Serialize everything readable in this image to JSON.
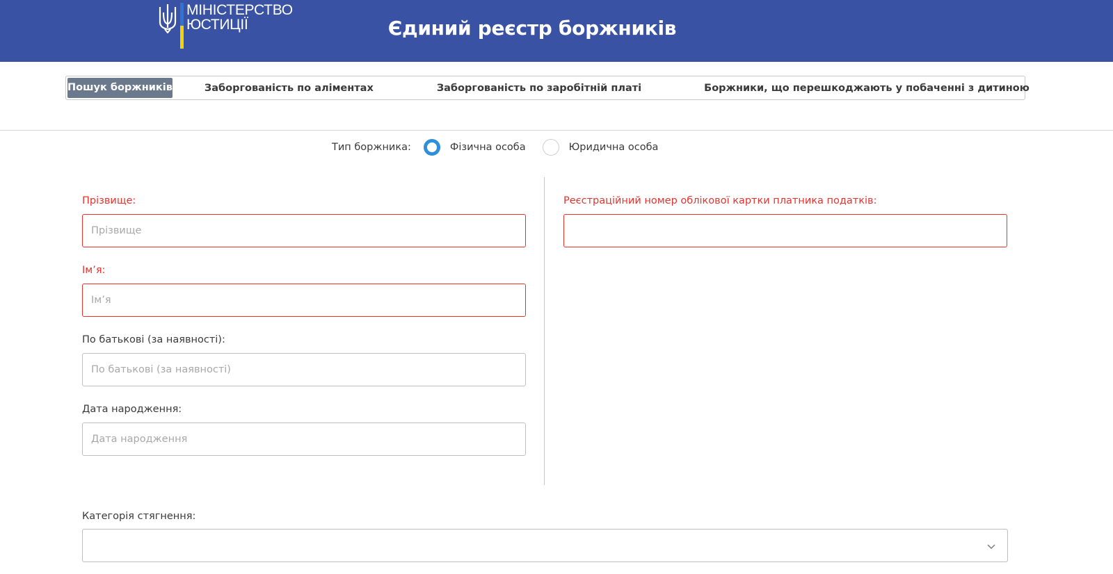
{
  "header": {
    "logo_line1": "МІНІСТЕРСТВО",
    "logo_line2": "ЮСТИЦІЇ",
    "title": "Єдиний реєстр боржників"
  },
  "tabs": [
    {
      "label": "Пошук боржників",
      "active": true
    },
    {
      "label": "Заборгованість по аліментах",
      "active": false
    },
    {
      "label": "Заборгованість по заробітній платі",
      "active": false
    },
    {
      "label": "Боржники, що перешкоджають у побаченні з дитиною",
      "active": false
    }
  ],
  "debtor_type": {
    "label": "Тип боржника:",
    "options": [
      {
        "label": "Фізична особа",
        "selected": true
      },
      {
        "label": "Юридична особа",
        "selected": false
      }
    ]
  },
  "form": {
    "surname": {
      "label": "Прізвище:",
      "placeholder": "Прізвище",
      "value": ""
    },
    "name": {
      "label": "Ім’я:",
      "placeholder": "Ім’я",
      "value": ""
    },
    "patronymic": {
      "label": "По батькові (за наявності):",
      "placeholder": "По батькові (за наявності)",
      "value": ""
    },
    "birth_date": {
      "label": "Дата народження:",
      "placeholder": "Дата народження",
      "value": ""
    },
    "tax_number": {
      "label": "Реєстраційний номер облікової картки платника податків:",
      "placeholder": "",
      "value": ""
    },
    "category": {
      "label": "Категорія стягнення:",
      "value": ""
    }
  },
  "colors": {
    "header_bg": "#3a52a3",
    "active_tab_bg": "#6a7a8c",
    "required_red": "#e8322e",
    "radio_blue": "#2f8fd8",
    "flag_blue": "#2f74d0",
    "flag_yellow": "#f5d300"
  }
}
